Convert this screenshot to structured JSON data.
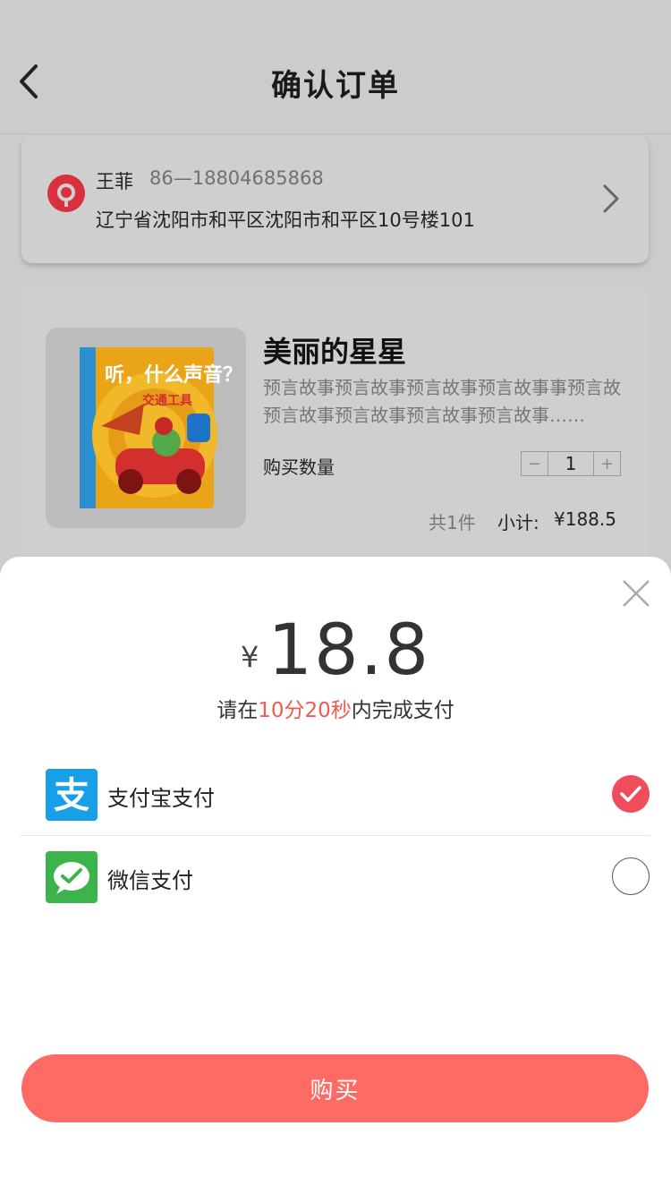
{
  "header": {
    "title": "确认订单"
  },
  "address": {
    "name": "王菲",
    "phone": "86—18804685868",
    "line": "辽宁省沈阳市和平区沈阳市和平区10号楼101"
  },
  "product": {
    "title": "美丽的星星",
    "description": "预言故事预言故事预言故事预言故事事预言故预言故事预言故事预言故事预言故事……",
    "quantity_label": "购买数量",
    "quantity_value": "1",
    "minus": "−",
    "plus": "+",
    "count_text": "共1件",
    "subtotal_label": "小计:",
    "subtotal_value": "¥188.5",
    "cover": {
      "title": "听，什么声音？",
      "subtitle": "交通工具"
    }
  },
  "payment": {
    "currency": "¥",
    "amount": "18.8",
    "timer_prefix": "请在",
    "timer_time": "10分20秒",
    "timer_suffix": "内完成支付",
    "methods": [
      {
        "label": "支付宝支付",
        "icon": "alipay-icon",
        "selected": true
      },
      {
        "label": "微信支付",
        "icon": "wechat-pay-icon",
        "selected": false
      }
    ],
    "buy_label": "购买"
  },
  "colors": {
    "accent_red": "#f05a4f",
    "buy_button": "#fe6a64",
    "radio_selected": "#ef4d5b",
    "alipay_blue": "#17a0e8",
    "wechat_green": "#3cb34b"
  }
}
